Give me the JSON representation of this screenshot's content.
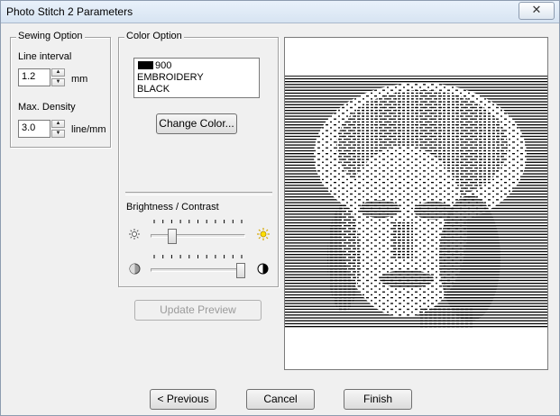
{
  "window": {
    "title": "Photo Stitch 2 Parameters",
    "close_glyph": "✕"
  },
  "sewing_option": {
    "legend": "Sewing Option",
    "line_interval": {
      "label": "Line interval",
      "value": "1.2",
      "unit": "mm"
    },
    "max_density": {
      "label": "Max. Density",
      "value": "3.0",
      "unit": "line/mm"
    }
  },
  "color_option": {
    "legend": "Color Option",
    "color": {
      "swatch": "#000000",
      "code": "900",
      "type": "EMBROIDERY",
      "name": "BLACK"
    },
    "change_color_label": "Change Color...",
    "brightness_contrast_label": "Brightness / Contrast",
    "brightness": {
      "level": 0.2,
      "low_icon": "sun-dim-icon",
      "high_icon": "sun-bright-icon"
    },
    "contrast": {
      "level": 1.0,
      "low_icon": "contrast-low-icon",
      "high_icon": "contrast-high-icon"
    }
  },
  "update_preview_label": "Update Preview",
  "footer": {
    "previous_label": "< Previous",
    "cancel_label": "Cancel",
    "finish_label": "Finish"
  }
}
